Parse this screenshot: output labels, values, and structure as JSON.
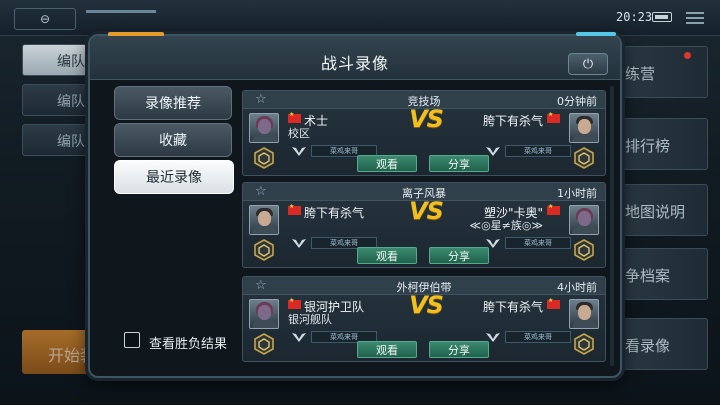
{
  "status_bar": {
    "time": "20:23"
  },
  "background": {
    "left_buttons": [
      "编队",
      "编队",
      "编队"
    ],
    "start_button": "开始装",
    "right_buttons": [
      "练营",
      "排行榜",
      "地图说明",
      "争档案",
      "看录像"
    ]
  },
  "dialog": {
    "title": "战斗录像",
    "tabs": [
      "录像推荐",
      "收藏",
      "最近录像"
    ],
    "active_tab": "最近录像",
    "checkbox_label": "查看胜负结果",
    "vs_label": "VS",
    "watch_label": "观看",
    "share_label": "分享"
  },
  "matches": [
    {
      "arena": "竞技场",
      "time": "0分钟前",
      "left": {
        "name": "术士",
        "subtitle": "校区",
        "tag": "菜鸡来哥"
      },
      "right": {
        "name": "胯下有杀气",
        "subtitle": "",
        "tag": "菜鸡来哥"
      }
    },
    {
      "arena": "离子风暴",
      "time": "1小时前",
      "left": {
        "name": "胯下有杀气",
        "subtitle": "",
        "tag": "菜鸡来哥"
      },
      "right": {
        "name": "塑沙\"卡奥\"",
        "subtitle": "≪◎星≠族◎≫",
        "tag": "菜鸡来哥"
      }
    },
    {
      "arena": "外柯伊伯带",
      "time": "4小时前",
      "left": {
        "name": "银河护卫队",
        "subtitle": "银河舰队",
        "tag": "菜鸡来哥"
      },
      "right": {
        "name": "胯下有杀气",
        "subtitle": "",
        "tag": "菜鸡来哥"
      }
    }
  ]
}
